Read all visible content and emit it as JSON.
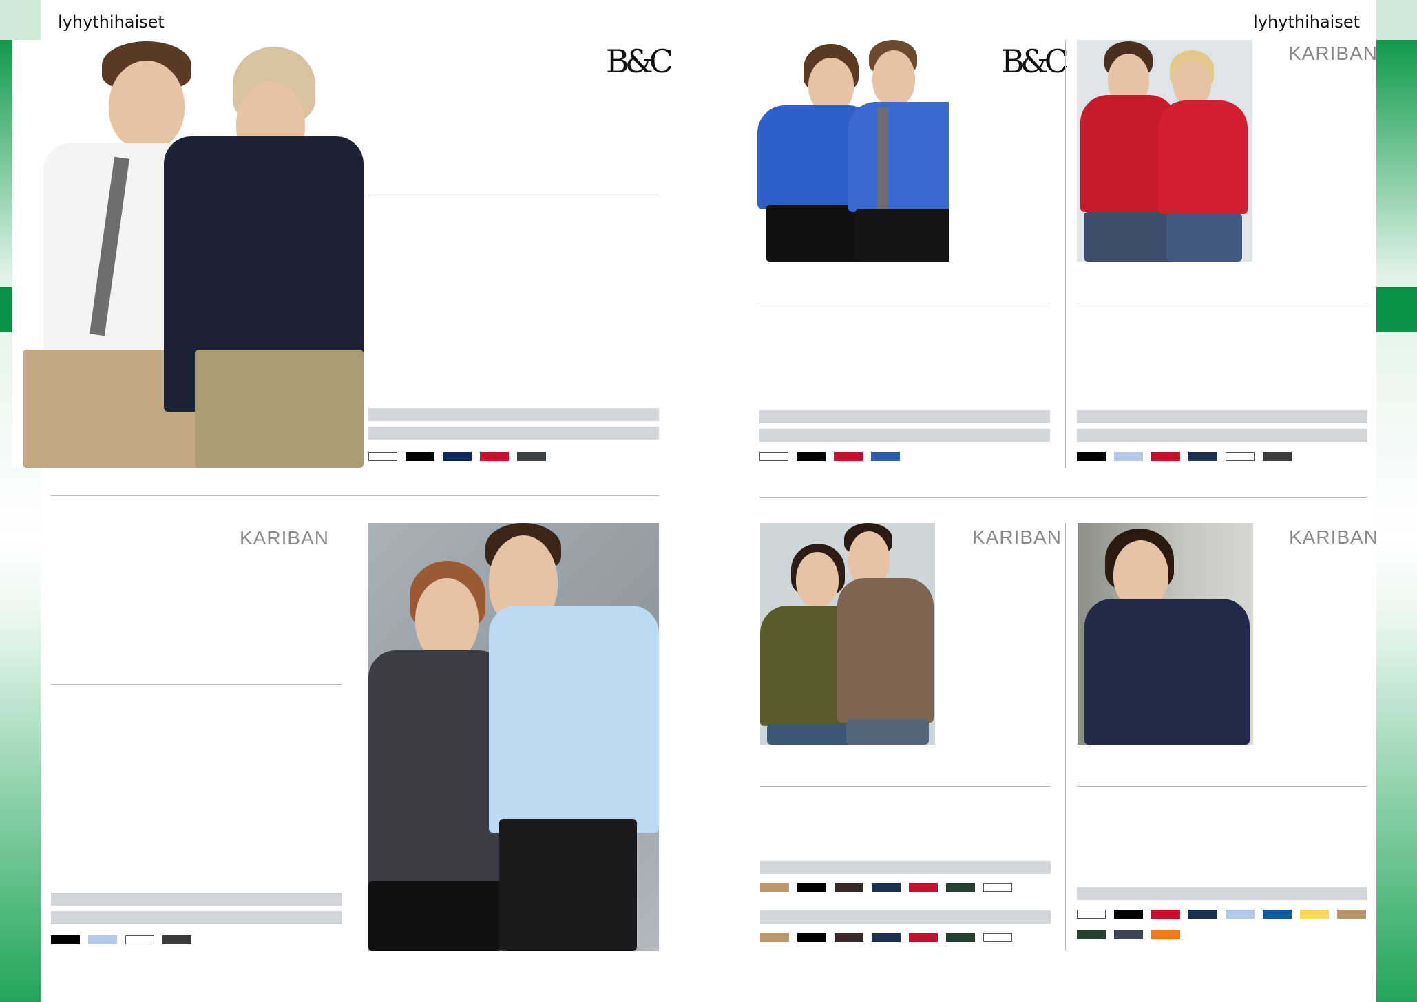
{
  "header": {
    "title_left": "lyhythihaiset",
    "title_right": "lyhythihaiset"
  },
  "logos": {
    "bc": "B&C",
    "kariban": "KARIBAN"
  },
  "colors": {
    "green": "#079247",
    "white": "#ffffff",
    "black": "#000000",
    "navy": "#0f2a5c",
    "red": "#c8102e",
    "charcoal": "#3a3f44",
    "royal": "#2a5db0",
    "lightblue": "#b4c8ea",
    "darkgrey": "#3b3b3b",
    "beige": "#b9976a",
    "chocolate": "#3a2a2a",
    "bottle": "#26402e",
    "yellow": "#f7d960",
    "darknavy": "#1c3150",
    "cobalt": "#0e5ba8",
    "slate": "#3d4456",
    "orange": "#ef7d1a"
  },
  "products": [
    {
      "brand": "B&C",
      "swatches": [
        "white",
        "black",
        "navy",
        "red",
        "charcoal"
      ]
    },
    {
      "brand": "B&C",
      "swatches": [
        "white",
        "black",
        "red",
        "royal"
      ]
    },
    {
      "brand": "KARIBAN",
      "swatches": [
        "black",
        "lightblue",
        "red",
        "darknavy",
        "white",
        "darkgrey"
      ]
    },
    {
      "brand": "KARIBAN",
      "swatches": [
        "black",
        "lightblue",
        "white",
        "darkgrey"
      ]
    },
    {
      "brand": "KARIBAN",
      "swatches_a": [
        "beige",
        "black",
        "chocolate",
        "darknavy",
        "red",
        "bottle",
        "white"
      ],
      "swatches_b": [
        "beige",
        "black",
        "chocolate",
        "darknavy",
        "red",
        "bottle",
        "white"
      ]
    },
    {
      "brand": "KARIBAN",
      "swatches": [
        "white",
        "black",
        "red",
        "darknavy",
        "lightblue",
        "cobalt",
        "yellow",
        "beige",
        "bottle",
        "slate",
        "orange"
      ]
    }
  ]
}
